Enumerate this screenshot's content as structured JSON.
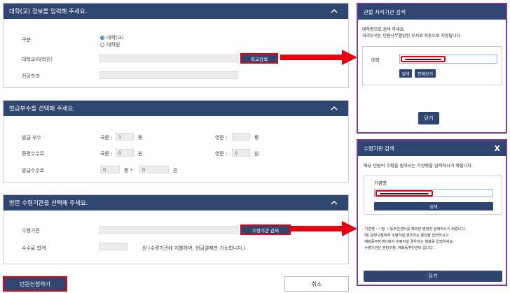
{
  "section1": {
    "title": "대학(교) 정보를 입력해 주세요.",
    "type_label": "구분",
    "type_options": [
      "대학(교)",
      "대학원"
    ],
    "univ_label": "대학교(대학원)",
    "school_search_btn": "학교검색",
    "major_label": "전공학과"
  },
  "section2": {
    "title": "발급부수를 선택해 주세요.",
    "copies_label": "발급 부수",
    "korean_label": "국문 :",
    "korean_value": "1",
    "unit_copies": "통",
    "english_label": "영문 :",
    "fee_label": "증명수수료",
    "fee_korean_label": "국문 :",
    "fee_korean_value": "0",
    "unit_won": "원",
    "fee_english_label": "영문 :",
    "fee_english_value": "0",
    "issue_fee_label": "발급수수료",
    "issue_fee_a": "0",
    "issue_fee_mult": "통 *",
    "issue_fee_b": "0",
    "issue_fee_unit": "원"
  },
  "section3": {
    "title": "방문 수령기관을 선택해 주세요.",
    "agency_label": "수령기관",
    "agency_search_btn": "수령기관 검색",
    "total_label": "수수료 합계",
    "total_unit_note": "원 (수령기관에 지불하며, 현금결제만 가능합니다.)"
  },
  "buttons": {
    "submit": "민원신청하기",
    "cancel": "취소"
  },
  "dialog1": {
    "title": "관할 처리기관 검색",
    "desc_line1": "대학명으로 검색 하세요.",
    "desc_line2": "처리부서는 민원사무할당된 부서로 자동으로 지정됩니다.",
    "field_label": "대학",
    "search_btn": "검색",
    "all_btn": "전체보기",
    "close_btn": "닫기"
  },
  "dialog2": {
    "title": "수령기관 검색",
    "close_x": "X",
    "desc": "해당 민원의 수령을 원하시는 기관명을 입력하시기 바랍니다.",
    "field_label": "기관명",
    "search_btn": "검색",
    "note1": "- 기관명 : ~청, ~동주민센터를 제외한 명칭만 입력하시기 바랍니다.",
    "note2": "  예) 분당구청에서 수령하실 경우라는 분당을 입력하시고",
    "note3": "  해화동주민센터에서 수령하실 경우라는 해화를 입력하세요.",
    "note4": "  수령기관은 분당구청, 해화동주민센터 입니다.",
    "close_btn": "닫기"
  },
  "colors": {
    "header_navy": "#2f4670",
    "highlight_red": "#e60012",
    "dialog_border": "#7a3aa0"
  }
}
